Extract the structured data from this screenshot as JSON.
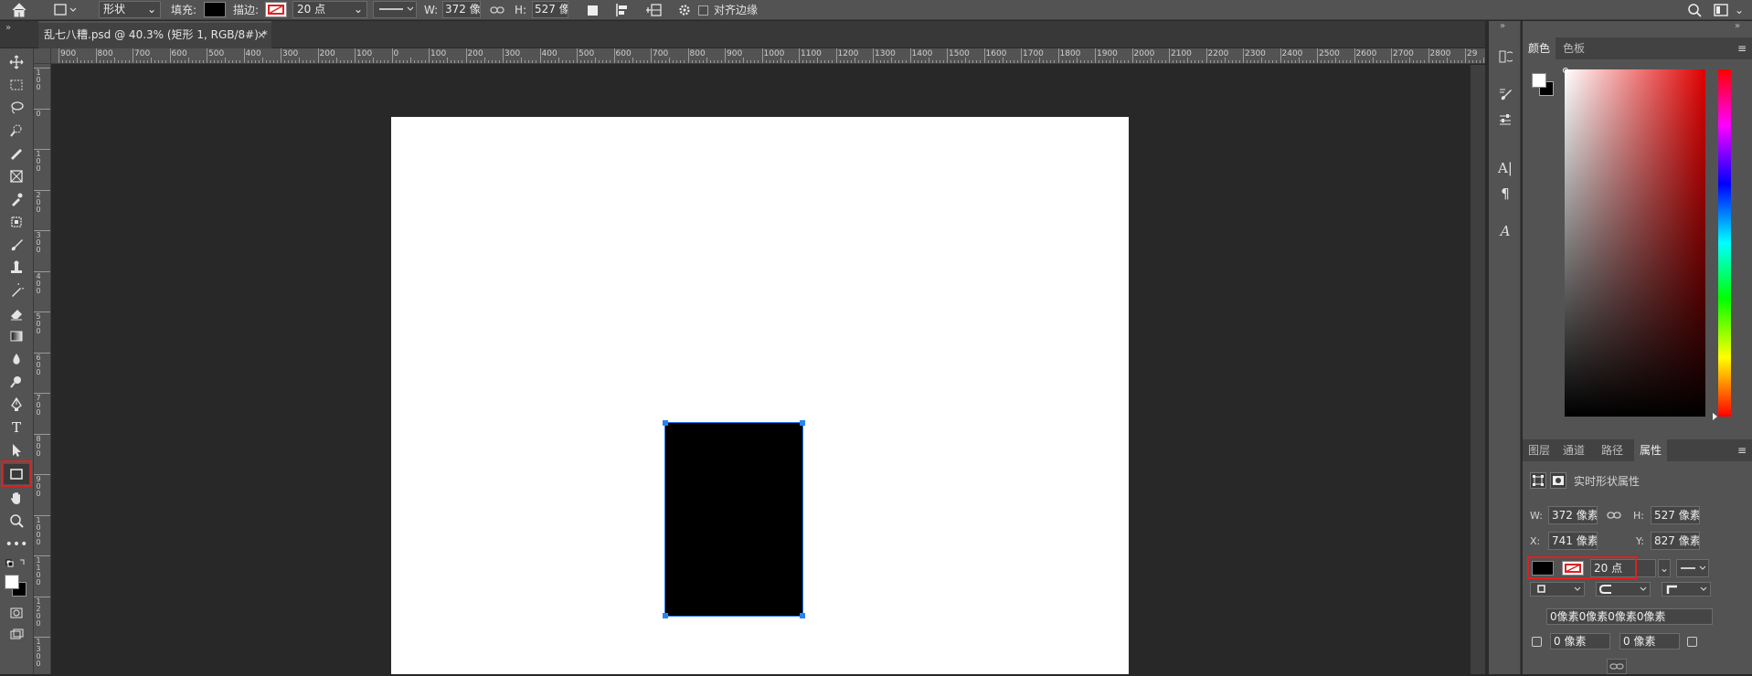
{
  "options_bar": {
    "mode_value": "形状",
    "fill_label": "填充:",
    "stroke_label": "描边:",
    "stroke_width_value": "20 点",
    "w_label": "W:",
    "w_value": "372 像",
    "h_label": "H:",
    "h_value": "527 像",
    "align_edges_label": "对齐边缘",
    "fill_color": "#000000"
  },
  "document_tab": {
    "title": "乱七八糟.psd @ 40.3% (矩形 1, RGB/8#) *",
    "close_glyph": "×"
  },
  "ruler_top": [
    "900",
    "800",
    "700",
    "600",
    "500",
    "400",
    "300",
    "200",
    "100",
    "0",
    "100",
    "200",
    "300",
    "400",
    "500",
    "600",
    "700",
    "800",
    "900",
    "1000",
    "1100",
    "1200",
    "1300",
    "1400",
    "1500",
    "1600",
    "1700",
    "1800",
    "1900",
    "2000",
    "2100",
    "2200",
    "2300",
    "2400",
    "2500",
    "2600",
    "2700",
    "2800",
    "29"
  ],
  "ruler_left": [
    "1\n0\n0",
    "0",
    "1\n0\n0",
    "2\n0\n0",
    "3\n0\n0",
    "4\n0\n0",
    "5\n0\n0",
    "6\n0\n0",
    "7\n0\n0",
    "8\n0\n0",
    "9\n0\n0",
    "1\n0\n0\n0",
    "1\n1\n0\n0",
    "1\n2\n0\n0",
    "1\n3\n0\n0"
  ],
  "color_panel": {
    "tabs": [
      "颜色",
      "色板"
    ],
    "active_tab": 0,
    "foreground": "#ffffff",
    "background": "#000000",
    "hue_color": "#e00000"
  },
  "properties_panel": {
    "tabs": [
      "图层",
      "通道",
      "路径",
      "属性"
    ],
    "active_tab": 3,
    "header": "实时形状属性",
    "w_label": "W:",
    "w_value": "372 像素",
    "h_label": "H:",
    "h_value": "527 像素",
    "x_label": "X:",
    "x_value": "741 像素",
    "y_label": "Y:",
    "y_value": "827 像素",
    "stroke_width": "20 点",
    "corner_radius_combined": "0像素0像素0像素0像素",
    "corner_tl": "0 像素",
    "corner_tr": "0 像素"
  },
  "colors": {
    "highlight": "#e02020",
    "selection": "#1e79e6",
    "shape_fill": "#000000"
  }
}
